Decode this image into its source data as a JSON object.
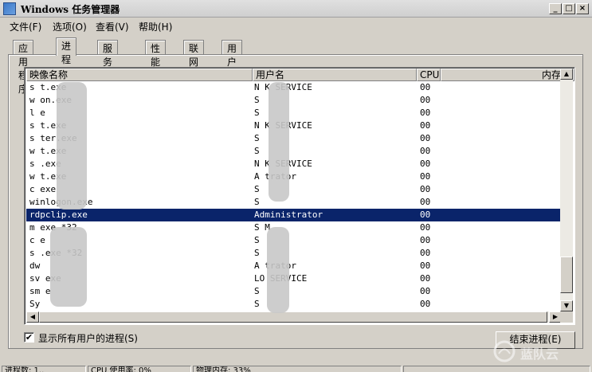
{
  "window": {
    "title": "Windows 任务管理器",
    "minimize": "_",
    "maximize": "□",
    "close": "×"
  },
  "menu": [
    "文件(F)",
    "选项(O)",
    "查看(V)",
    "帮助(H)"
  ],
  "tabs": [
    "应用程序",
    "进程",
    "服务",
    "性能",
    "联网",
    "用户"
  ],
  "active_tab": "进程",
  "columns": {
    "name": "映像名称",
    "user": "用户名",
    "cpu": "CPU",
    "mem": "内存"
  },
  "processes": [
    {
      "name": "s    t.exe",
      "user": "N     K SERVICE",
      "cpu": "00"
    },
    {
      "name": "w    on.exe",
      "user": "S",
      "cpu": "00"
    },
    {
      "name": "l    e",
      "user": "S",
      "cpu": "00"
    },
    {
      "name": "s    t.exe",
      "user": "N     K SERVICE",
      "cpu": "00"
    },
    {
      "name": "s    ter.exe",
      "user": "S",
      "cpu": "00"
    },
    {
      "name": "w    t.exe",
      "user": "S",
      "cpu": "00"
    },
    {
      "name": "s    .exe",
      "user": "N     K SERVICE",
      "cpu": "00"
    },
    {
      "name": "w    t.exe",
      "user": "A     trator",
      "cpu": "00"
    },
    {
      "name": "c    exe",
      "user": "S",
      "cpu": "00"
    },
    {
      "name": "winlogon.exe",
      "user": "S",
      "cpu": "00"
    },
    {
      "name": "rdpclip.exe",
      "user": "Administrator",
      "cpu": "00"
    },
    {
      "name": "m       exe *32",
      "user": "S     M",
      "cpu": "00"
    },
    {
      "name": "c       e",
      "user": "S",
      "cpu": "00"
    },
    {
      "name": "s      .exe *32",
      "user": "S",
      "cpu": "00"
    },
    {
      "name": "dw",
      "user": "A     trator",
      "cpu": "00"
    },
    {
      "name": "sv      exe",
      "user": "LO      SERVICE",
      "cpu": "00"
    },
    {
      "name": "sm      e",
      "user": "S",
      "cpu": "00"
    },
    {
      "name": "Sy",
      "user": "S",
      "cpu": "00"
    }
  ],
  "selected_row": "rdpclip.exe",
  "show_all_users": {
    "label": "显示所有用户的进程(S)",
    "checked": true,
    "mark": "✔"
  },
  "end_process_button": "结束进程(E)",
  "status": {
    "processes": "进程数: 1..",
    "cpu": "CPU 使用率: 0%",
    "memory": "物理内存: 33%"
  },
  "watermark": "蓝队云",
  "colors": {
    "selection": "#0a246a",
    "face": "#d4d0c8"
  }
}
